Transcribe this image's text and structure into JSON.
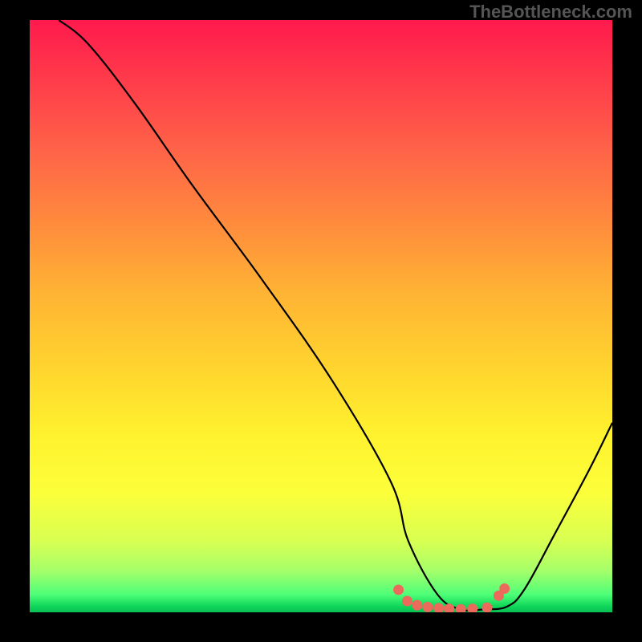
{
  "watermark": "TheBottleneck.com",
  "chart_data": {
    "type": "line",
    "title": "",
    "xlabel": "",
    "ylabel": "",
    "xlim": [
      0,
      100
    ],
    "ylim": [
      0,
      100
    ],
    "series": [
      {
        "name": "bottleneck-curve",
        "x": [
          5,
          10,
          18,
          28,
          40,
          52,
          62,
          65,
          70,
          74,
          78,
          82,
          85,
          90,
          96,
          100
        ],
        "values": [
          100,
          96,
          86,
          72,
          56,
          39,
          22,
          12,
          3,
          0.5,
          0.5,
          1,
          4,
          13,
          24,
          32
        ]
      }
    ],
    "dots": {
      "name": "accent-dots",
      "color": "#ec6a5b",
      "points": [
        {
          "x": 63.3,
          "y": 3.8
        },
        {
          "x": 64.8,
          "y": 1.9
        },
        {
          "x": 66.5,
          "y": 1.2
        },
        {
          "x": 68.3,
          "y": 0.9
        },
        {
          "x": 70.2,
          "y": 0.7
        },
        {
          "x": 72.0,
          "y": 0.6
        },
        {
          "x": 74.0,
          "y": 0.5
        },
        {
          "x": 76.0,
          "y": 0.6
        },
        {
          "x": 78.5,
          "y": 0.8
        },
        {
          "x": 80.5,
          "y": 2.8
        },
        {
          "x": 81.5,
          "y": 4.0
        }
      ]
    }
  }
}
